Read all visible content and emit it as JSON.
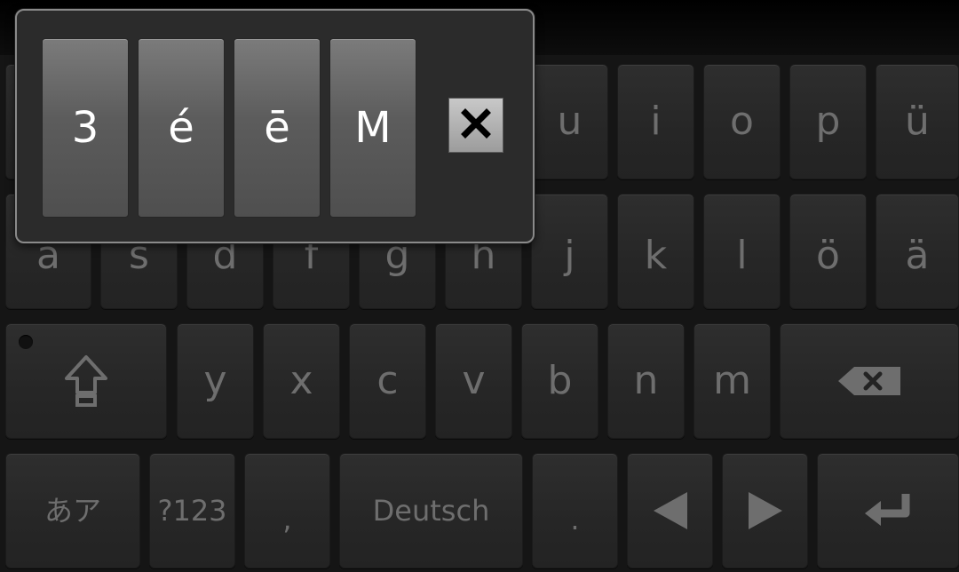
{
  "keyboard": {
    "row1": [
      "u",
      "i",
      "o",
      "p",
      "ü"
    ],
    "row2": [
      "a",
      "s",
      "d",
      "f",
      "g",
      "h",
      "j",
      "k",
      "l",
      "ö",
      "ä"
    ],
    "row3": {
      "shift_icon": "shift-arrow-icon",
      "letters": [
        "y",
        "x",
        "c",
        "v",
        "b",
        "n",
        "m"
      ],
      "backspace_icon": "backspace-icon"
    },
    "row4": {
      "kana_label": "あア",
      "symbols_label": "?123",
      "comma_label": ",",
      "space_label": "Deutsch",
      "period_label": ".",
      "left_icon": "left-arrow-icon",
      "right_icon": "right-arrow-icon",
      "enter_icon": "enter-icon"
    }
  },
  "popup": {
    "candidates": [
      "3",
      "é",
      "ē",
      "M"
    ],
    "close_icon": "close-icon"
  },
  "colors": {
    "key_text": "#6e6e6e",
    "popup_key_text": "#ffffff",
    "popup_border": "#8a8a8a"
  }
}
